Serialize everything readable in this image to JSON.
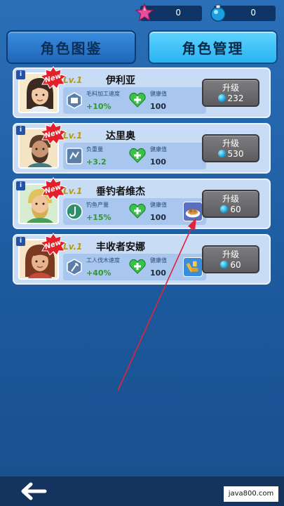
{
  "resources": {
    "star_count": "0",
    "gem_count": "0"
  },
  "tabs": {
    "album_label": "角色图鉴",
    "manage_label": "角色管理"
  },
  "characters": [
    {
      "level": "Lv.1",
      "name": "伊利亚",
      "stat_label": "毛料加工速度",
      "stat_value": "+10%",
      "hp_label": "健康值",
      "hp_value": "100",
      "upgrade_label": "升级",
      "upgrade_cost": "232",
      "has_item": false
    },
    {
      "level": "Lv.1",
      "name": "达里奥",
      "stat_label": "负重量",
      "stat_value": "+3.2",
      "hp_label": "健康值",
      "hp_value": "100",
      "upgrade_label": "升级",
      "upgrade_cost": "530",
      "has_item": false
    },
    {
      "level": "Lv.1",
      "name": "垂钓者维杰",
      "stat_label": "钓鱼产量",
      "stat_value": "+15%",
      "hp_label": "健康值",
      "hp_value": "100",
      "upgrade_label": "升级",
      "upgrade_cost": "60",
      "has_item": true,
      "item_icon": "food-plate-icon"
    },
    {
      "level": "Lv.1",
      "name": "丰收者安娜",
      "stat_label": "工人伐木速度",
      "stat_value": "+40%",
      "hp_label": "健康值",
      "hp_value": "100",
      "upgrade_label": "升级",
      "upgrade_cost": "60",
      "has_item": true,
      "item_icon": "gold-tool-icon"
    }
  ],
  "new_badge": "New",
  "info_badge": "i",
  "watermark": "java800.com",
  "colors": {
    "accent_tab": "#2ab3f1",
    "annotation_arrow": "#e0243a",
    "stat_green": "#2e9a2a",
    "level_gold": "#b89a10"
  }
}
